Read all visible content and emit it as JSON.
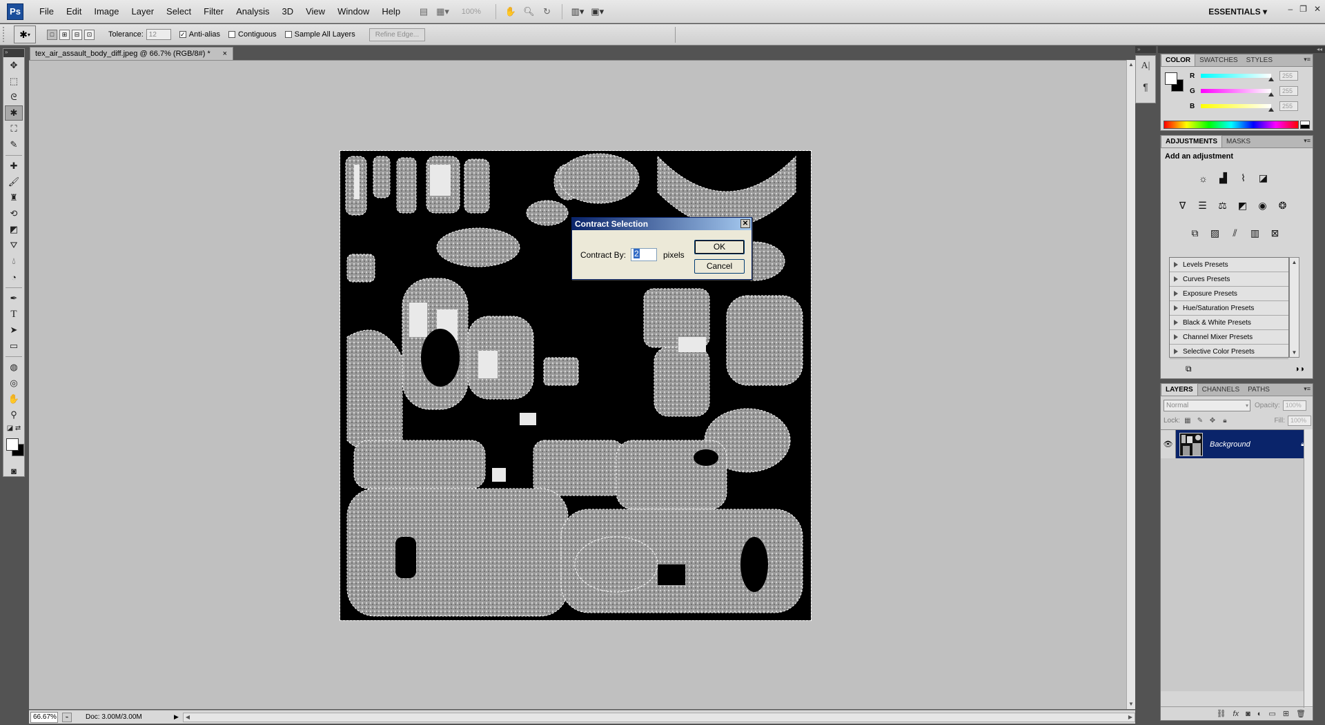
{
  "app": {
    "logo": "Ps",
    "menus": [
      "File",
      "Edit",
      "Image",
      "Layer",
      "Select",
      "Filter",
      "Analysis",
      "3D",
      "View",
      "Window",
      "Help"
    ],
    "zoom_display": "100%",
    "workspace": "ESSENTIALS",
    "window_controls": [
      "–",
      "❐",
      "✕"
    ]
  },
  "options": {
    "tolerance_label": "Tolerance:",
    "tolerance_value": "12",
    "anti_alias_label": "Anti-alias",
    "anti_alias_checked": true,
    "contiguous_label": "Contiguous",
    "contiguous_checked": false,
    "sample_all_label": "Sample All Layers",
    "sample_all_checked": false,
    "refine_edge_label": "Refine Edge..."
  },
  "document": {
    "tab_title": "tex_air_assault_body_diff.jpeg @ 66.7% (RGB/8#) *",
    "close_icon": "×"
  },
  "status": {
    "zoom": "66.67%",
    "doc_size": "Doc: 3.00M/3.00M"
  },
  "dialog": {
    "title": "Contract Selection",
    "label": "Contract By:",
    "value": "2",
    "unit": "pixels",
    "ok": "OK",
    "cancel": "Cancel"
  },
  "color_panel": {
    "tabs": [
      "COLOR",
      "SWATCHES",
      "STYLES"
    ],
    "sliders": [
      {
        "label": "R",
        "value": "255",
        "gradient": "#00ffff"
      },
      {
        "label": "G",
        "value": "255",
        "gradient": "#ff00ff"
      },
      {
        "label": "B",
        "value": "255",
        "gradient": "#ffff00"
      }
    ]
  },
  "adjustments_panel": {
    "tabs": [
      "ADJUSTMENTS",
      "MASKS"
    ],
    "title": "Add an adjustment",
    "presets": [
      "Levels Presets",
      "Curves Presets",
      "Exposure Presets",
      "Hue/Saturation Presets",
      "Black & White Presets",
      "Channel Mixer Presets",
      "Selective Color Presets"
    ]
  },
  "layers_panel": {
    "tabs": [
      "LAYERS",
      "CHANNELS",
      "PATHS"
    ],
    "blend_mode": "Normal",
    "opacity_label": "Opacity:",
    "opacity_value": "100%",
    "lock_label": "Lock:",
    "fill_label": "Fill:",
    "fill_value": "100%",
    "layers": [
      {
        "name": "Background",
        "visible": true,
        "locked": true
      }
    ]
  },
  "colors": {
    "selection_blue": "#0a246a",
    "canvas_gray": "#c0c0c0",
    "dark_ui": "#535353"
  }
}
